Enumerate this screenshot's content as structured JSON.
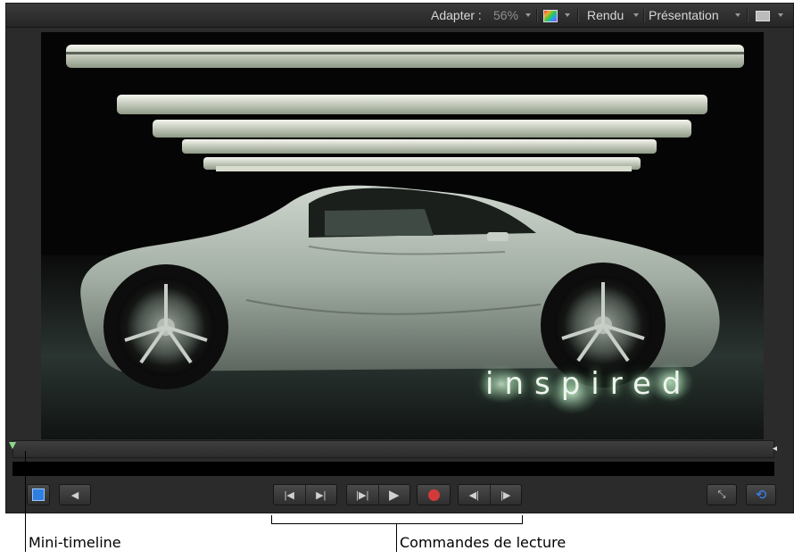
{
  "toolbar": {
    "fit_label": "Adapter :",
    "fit_value": "56%",
    "render_label": "Rendu",
    "view_label": "Présentation"
  },
  "canvas": {
    "overlay_text": "inspired"
  },
  "transport": {
    "colors": {
      "record": "#d23a3a",
      "loop": "#3b82f6",
      "playhead": "#8fd88a"
    }
  },
  "annotations": {
    "mini_timeline": "Mini-timeline",
    "playback_controls": "Commandes de lecture"
  }
}
